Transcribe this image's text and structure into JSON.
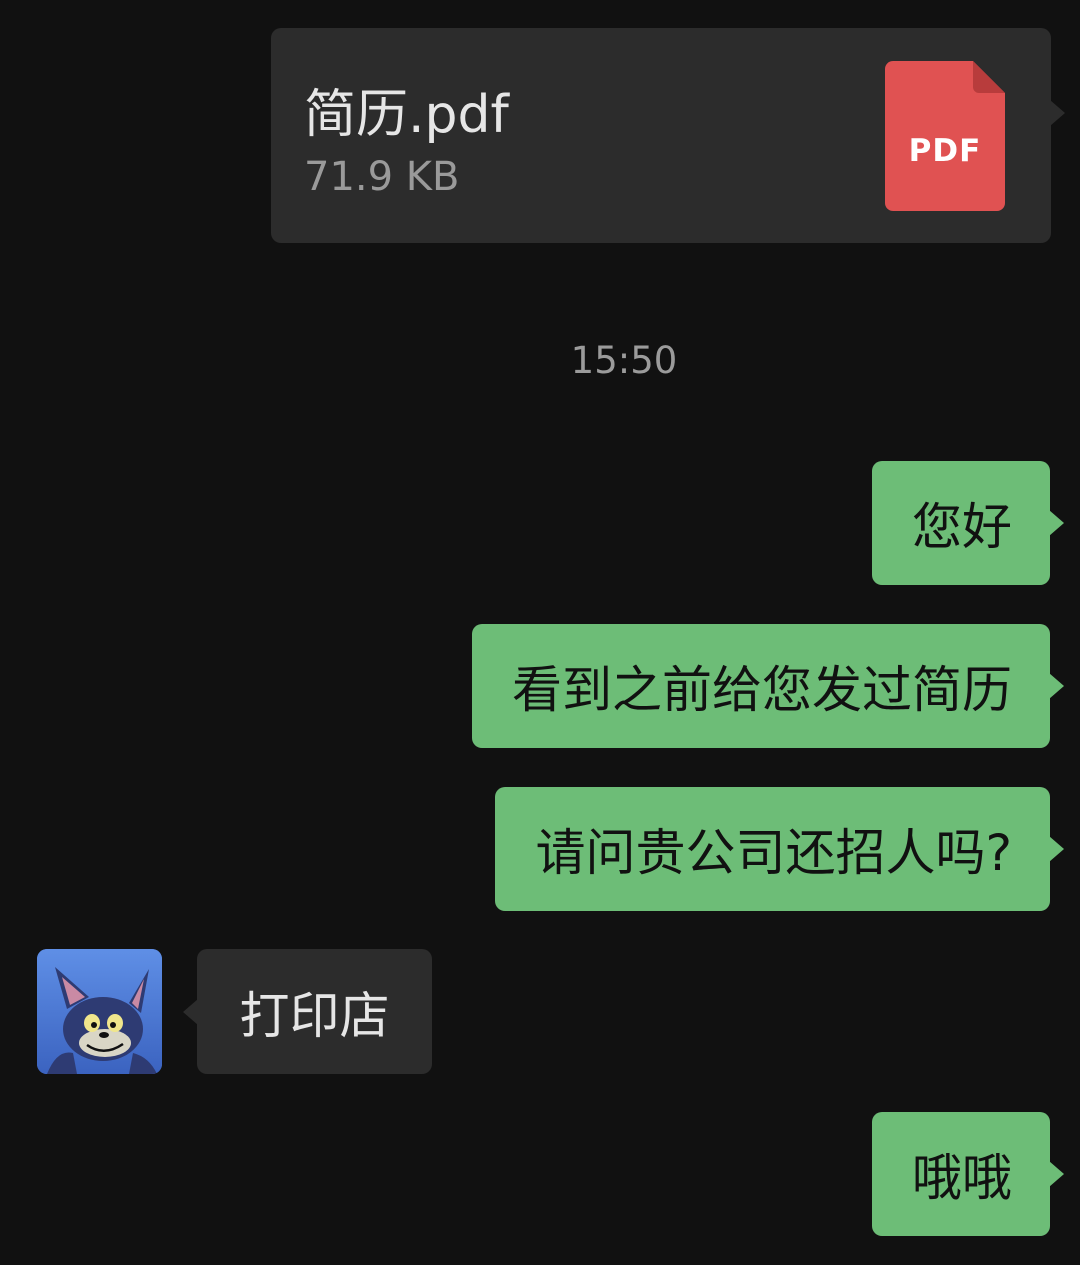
{
  "file_message": {
    "name": "简历.pdf",
    "size": "71.9 KB",
    "icon": "pdf-file-icon",
    "icon_label": "PDF",
    "icon_color": "#e05252"
  },
  "timestamp": "15:50",
  "messages": [
    {
      "direction": "out",
      "text": "您好"
    },
    {
      "direction": "out",
      "text": "看到之前给您发过简历"
    },
    {
      "direction": "out",
      "text": "请问贵公司还招人吗?"
    },
    {
      "direction": "in",
      "text": "打印店",
      "avatar": "cartoon-cat-avatar"
    },
    {
      "direction": "out",
      "text": "哦哦"
    }
  ],
  "colors": {
    "background": "#111111",
    "outgoing_bubble": "#6dbd77",
    "incoming_bubble": "#2c2c2c"
  }
}
